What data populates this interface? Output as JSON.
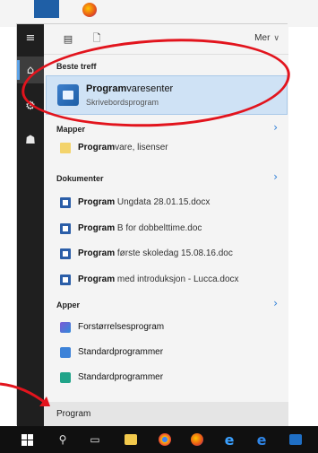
{
  "menu": {
    "toolbar": {
      "more_label": "Mer"
    },
    "sections": {
      "best_match": "Beste treff",
      "folders": "Mapper",
      "documents": "Dokumenter",
      "apps": "Apper"
    },
    "best_match": {
      "title_bold": "Program",
      "title_rest": "varesenter",
      "subtitle": "Skrivebordsprogram"
    },
    "folders": [
      {
        "bold": "Program",
        "rest": "vare, lisenser",
        "icon": "folder-icon"
      }
    ],
    "documents": [
      {
        "bold": "Program",
        "rest": " Ungdata 28.01.15.docx",
        "icon": "word-doc-icon"
      },
      {
        "bold": "Program",
        "rest": " B for dobbelttime.doc",
        "icon": "word-doc-icon"
      },
      {
        "bold": "Program",
        "rest": " første skoledag 15.08.16.doc",
        "icon": "word-doc-icon"
      },
      {
        "bold": "Program",
        "rest": " med introduksjon - Lucca.docx",
        "icon": "word-doc-icon"
      }
    ],
    "apps": [
      {
        "label": "Forstørrelsesprogram",
        "icon": "magnifier-app-icon"
      },
      {
        "label": "Standardprogrammer",
        "icon": "default-apps-icon"
      },
      {
        "label": "Standardprogrammer",
        "icon": "default-apps-settings-icon"
      }
    ],
    "search": {
      "query": "Program"
    }
  },
  "colors": {
    "highlight": "#cfe2f5",
    "annotation": "#e2141d",
    "accent": "#2b7dd6",
    "rail": "#1f1f1f",
    "taskbar": "#101010"
  }
}
